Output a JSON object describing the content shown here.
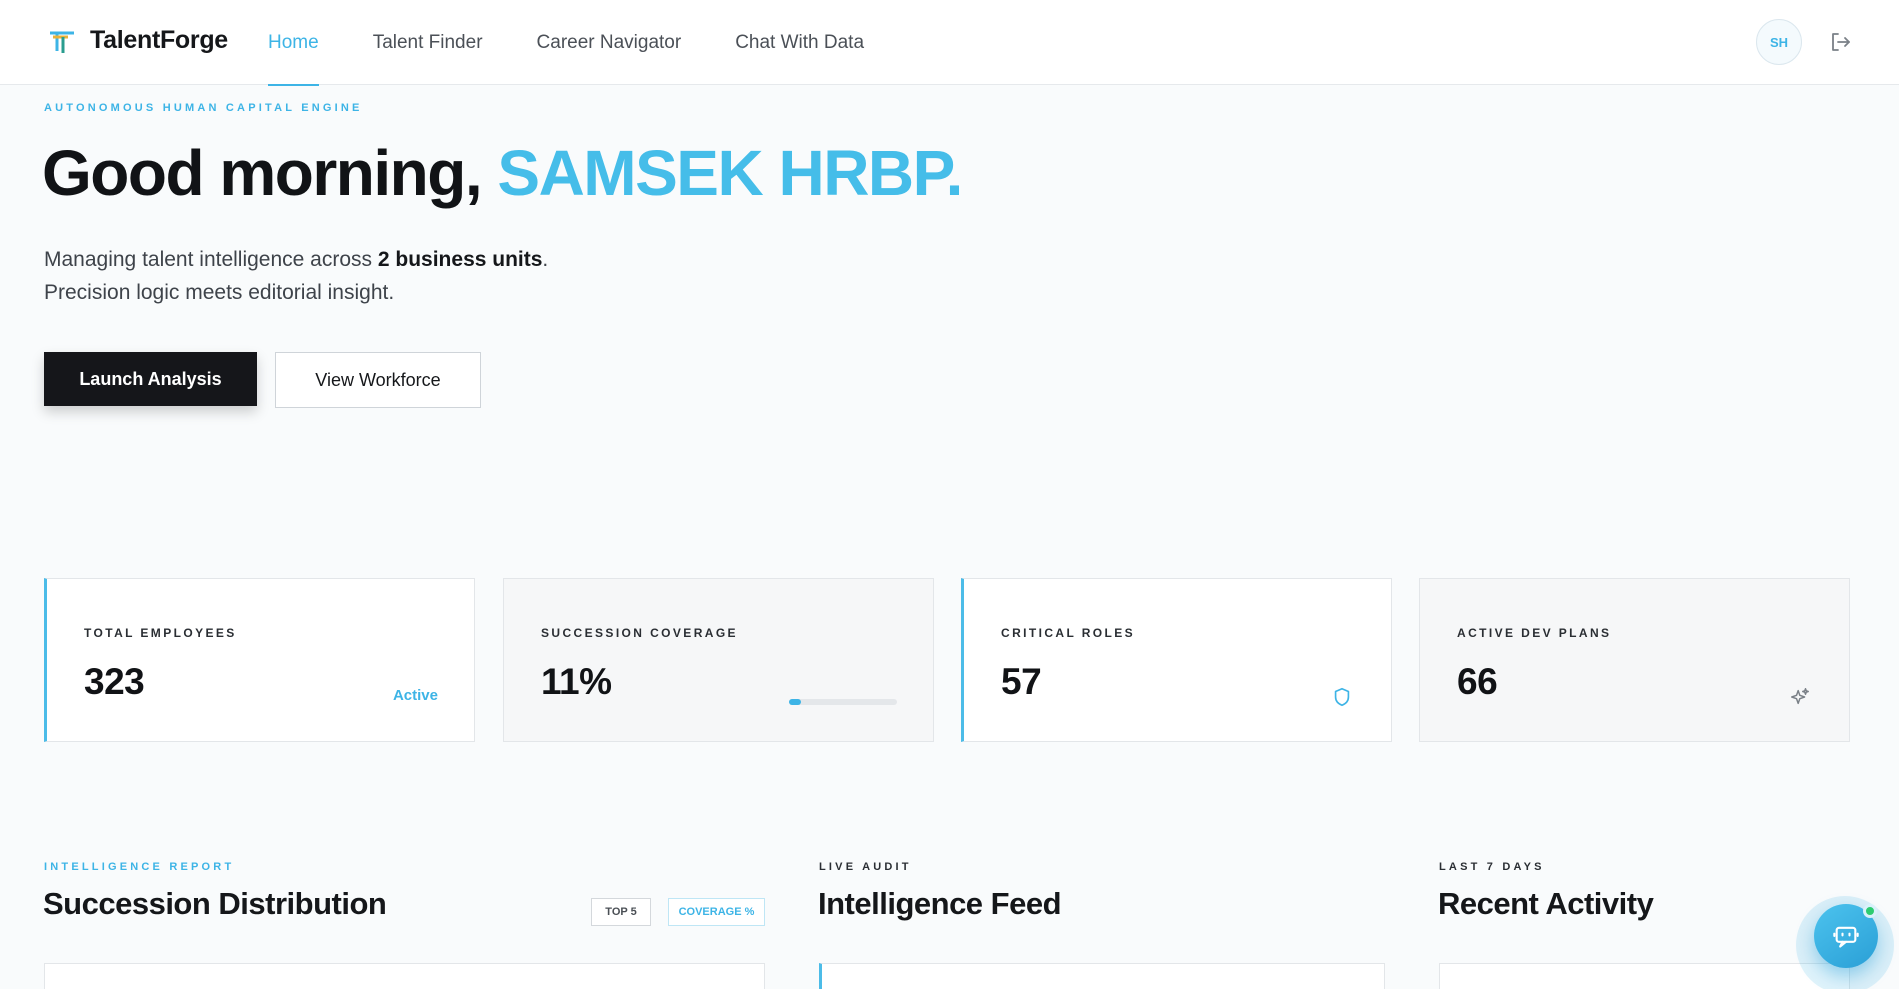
{
  "app": {
    "brand": "TalentForge"
  },
  "nav": {
    "items": [
      {
        "label": "Home",
        "active": true
      },
      {
        "label": "Talent Finder",
        "active": false
      },
      {
        "label": "Career Navigator",
        "active": false
      },
      {
        "label": "Chat With Data",
        "active": false
      }
    ]
  },
  "user": {
    "initials": "SH"
  },
  "hero": {
    "eyebrow": "AUTONOMOUS HUMAN CAPITAL ENGINE",
    "greeting_prefix": "Good morning, ",
    "greeting_name": "SAMSEK HRBP.",
    "sub_line1_prefix": "Managing talent intelligence across ",
    "sub_line1_bold": "2 business units",
    "sub_line1_suffix": ".",
    "sub_line2": "Precision logic meets editorial insight.",
    "primary_button": "Launch Analysis",
    "secondary_button": "View Workforce"
  },
  "stats": [
    {
      "label": "TOTAL EMPLOYEES",
      "value": "323",
      "badge": "Active"
    },
    {
      "label": "SUCCESSION COVERAGE",
      "value": "11%",
      "progress": 0.11
    },
    {
      "label": "CRITICAL ROLES",
      "value": "57",
      "icon": "shield-icon"
    },
    {
      "label": "ACTIVE DEV PLANS",
      "value": "66",
      "icon": "sparkles-icon"
    }
  ],
  "sections": {
    "succession": {
      "eyebrow": "INTELLIGENCE REPORT",
      "title": "Succession Distribution",
      "pill_top": "TOP 5",
      "pill_coverage": "COVERAGE %"
    },
    "feed": {
      "eyebrow": "LIVE AUDIT",
      "title": "Intelligence Feed"
    },
    "activity": {
      "eyebrow": "LAST 7 DAYS",
      "title": "Recent Activity"
    }
  },
  "colors": {
    "accent": "#3db4e6",
    "dark": "#15161a",
    "background": "#f9fbfc"
  }
}
